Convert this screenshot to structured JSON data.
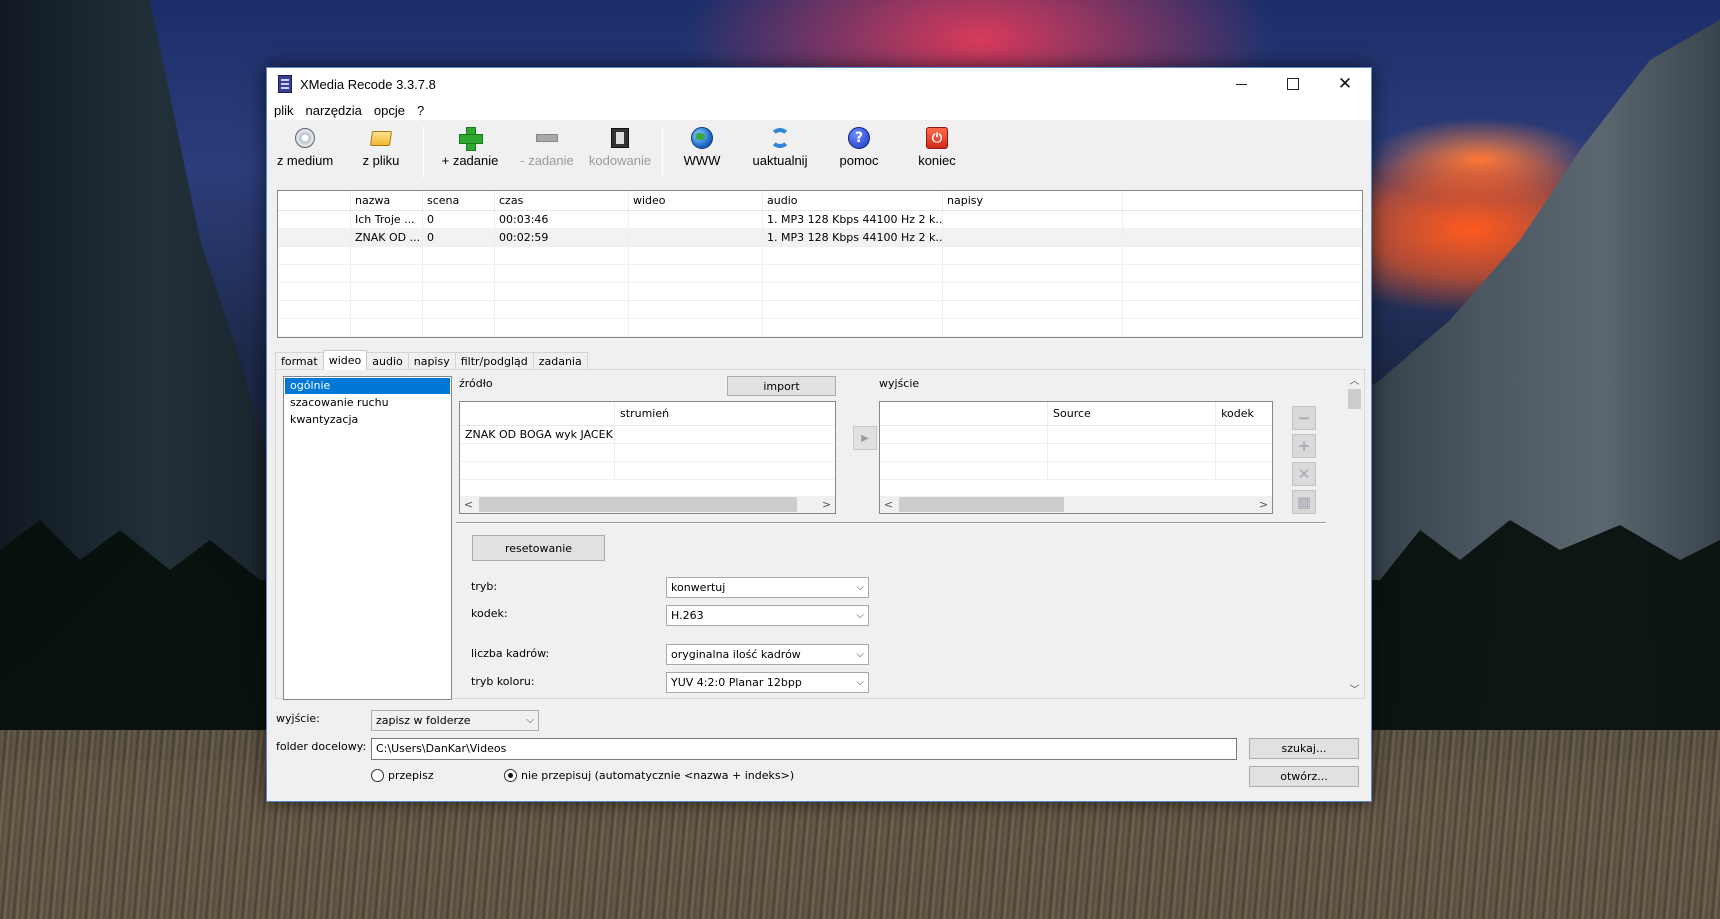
{
  "window": {
    "title": "XMedia Recode 3.3.7.8",
    "close_glyph": "✕"
  },
  "menu": [
    "plik",
    "narzędzia",
    "opcje",
    "?"
  ],
  "toolbar": {
    "from_disc": "z medium",
    "from_file": "z pliku",
    "add_job": "+ zadanie",
    "remove_job": "- zadanie",
    "encode": "kodowanie",
    "www": "WWW",
    "update": "uaktualnij",
    "help": "pomoc",
    "exit": "koniec",
    "help_glyph": "?",
    "exit_glyph": "⏻"
  },
  "icons": {
    "disc": "disc-icon",
    "folder": "folder-open-icon",
    "add": "green-plus-icon",
    "remove": "gray-minus-icon",
    "encode": "film-reel-icon",
    "www": "globe-icon",
    "update": "refresh-icon",
    "help": "help-icon",
    "exit": "power-icon"
  },
  "files": {
    "columns": [
      "",
      "nazwa",
      "scena",
      "czas",
      "wideo",
      "audio",
      "napisy",
      ""
    ],
    "rows": [
      {
        "name": "Ich Troje ...",
        "scene": "0",
        "time": "00:03:46",
        "video": "",
        "audio": "1. MP3 128 Kbps 44100 Hz 2 k...",
        "subs": ""
      },
      {
        "name": "ZNAK OD ...",
        "scene": "0",
        "time": "00:02:59",
        "video": "",
        "audio": "1. MP3 128 Kbps 44100 Hz 2 k...",
        "subs": ""
      }
    ]
  },
  "tabs": [
    "format",
    "wideo",
    "audio",
    "napisy",
    "filtr/podgląd",
    "zadania"
  ],
  "side_list": [
    "ogólnie",
    "szacowanie ruchu",
    "kwantyzacja"
  ],
  "source": {
    "label": "źródło",
    "import_label": "import",
    "col_stream": "strumień",
    "row_name": "ZNAK OD BOGA wyk JACEK ..."
  },
  "output": {
    "label": "wyjście",
    "col_source": "Source",
    "col_codec": "kodek"
  },
  "scroll": {
    "left": "<",
    "right": ">",
    "up": "︿",
    "down": "﹀",
    "play": "▶"
  },
  "side_tools": {
    "remove": "−",
    "add": "+",
    "delete": "✕",
    "grid": "▦"
  },
  "settings": {
    "reset_label": "resetowanie",
    "mode_label": "tryb:",
    "mode_value": "konwertuj",
    "codec_label": "kodek:",
    "codec_value": "H.263",
    "framerate_label": "liczba kadrów:",
    "framerate_value": "oryginalna ilość kadrów",
    "colormode_label": "tryb koloru:",
    "colormode_value": "YUV 4:2:0 Planar 12bpp",
    "chevron": "⌵"
  },
  "bottom": {
    "output_label": "wyjście:",
    "output_value": "zapisz w folderze",
    "folder_label": "folder docelowy:",
    "folder_value": "C:\\Users\\DanKar\\Videos",
    "browse_label": "szukaj...",
    "open_label": "otwórz...",
    "overwrite_label": "przepisz",
    "no_overwrite_label": "nie przepisuj (automatycznie <nazwa + indeks>)"
  }
}
